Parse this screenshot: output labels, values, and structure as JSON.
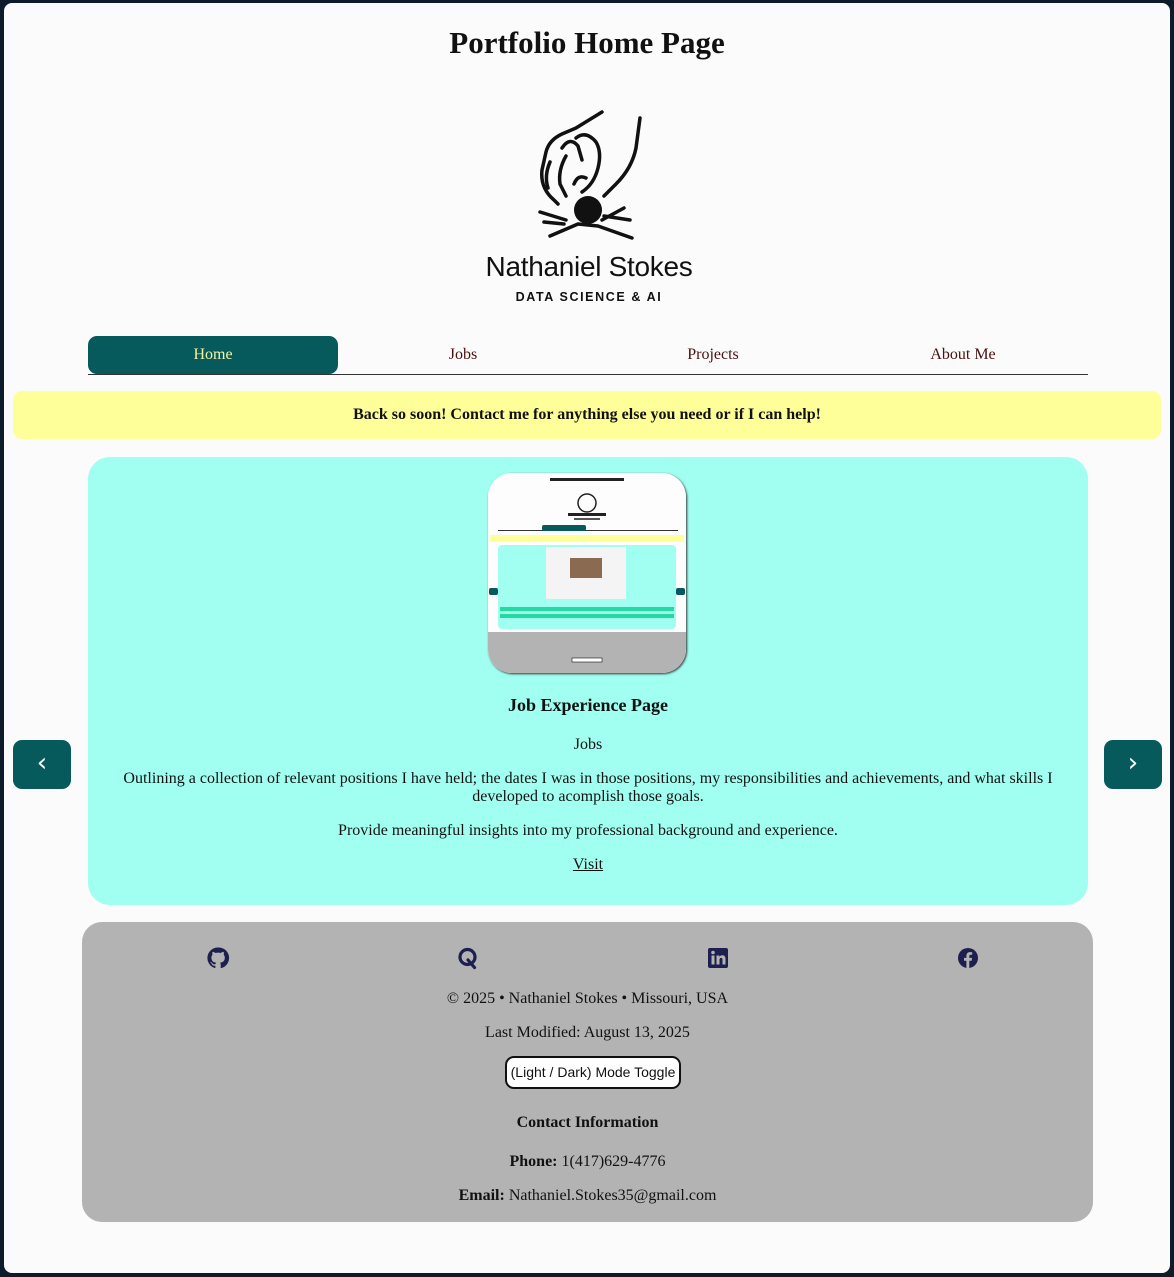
{
  "page": {
    "title": "Portfolio Home Page"
  },
  "logo": {
    "name": "Nathaniel Stokes",
    "subtitle": "DATA SCIENCE & AI"
  },
  "nav": {
    "items": [
      {
        "label": "Home",
        "active": true
      },
      {
        "label": "Jobs",
        "active": false
      },
      {
        "label": "Projects",
        "active": false
      },
      {
        "label": "About Me",
        "active": false
      }
    ]
  },
  "banner": {
    "text": "Back so soon! Contact me for anything else you need or if I can help!"
  },
  "carousel": {
    "prev_label": "‹",
    "next_label": "›",
    "card": {
      "title": "Job Experience Page",
      "category": "Jobs",
      "description": "Outlining a collection of relevant positions I have held; the dates I was in those positions, my responsibilities and achievements, and what skills I developed to acomplish those goals.",
      "insight": "Provide meaningful insights into my professional background and experience.",
      "link_label": "Visit"
    }
  },
  "footer": {
    "icons": [
      "github-icon",
      "quora-icon",
      "linkedin-icon",
      "facebook-icon"
    ],
    "copyright": "© 2025 • Nathaniel Stokes • Missouri, USA",
    "last_modified": "Last Modified: August 13, 2025",
    "toggle_label": "(Light / Dark) Mode Toggle",
    "contact_heading": "Contact Information",
    "phone_label": "Phone:",
    "phone": "1(417)629-4776",
    "email_label": "Email:",
    "email": "Nathaniel.Stokes35@gmail.com"
  },
  "colors": {
    "accent": "#065a5c",
    "banner": "#ffff99",
    "card": "#a0fff0",
    "footer": "#b3b3b3",
    "icon": "#1d1f4e"
  }
}
